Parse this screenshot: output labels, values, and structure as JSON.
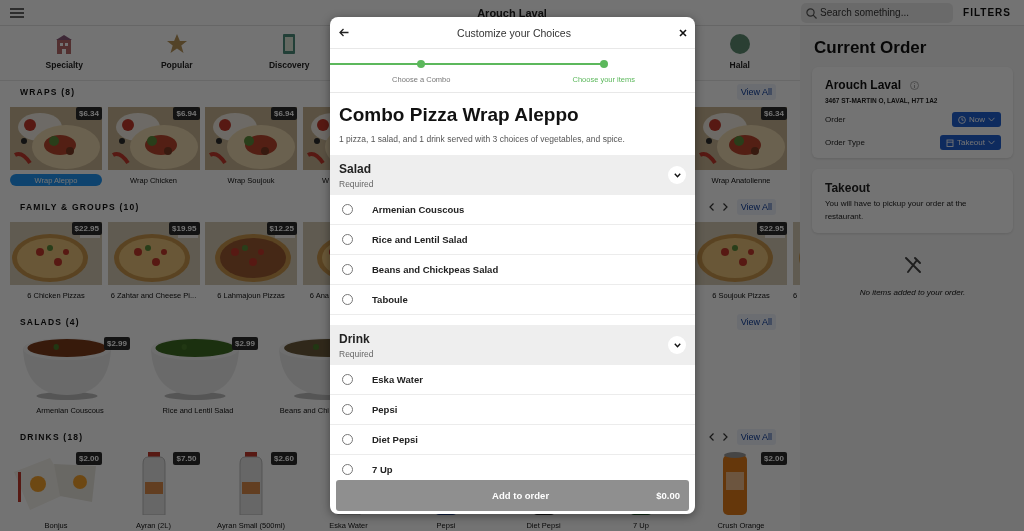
{
  "top_bar": {
    "title": "Arouch Laval",
    "search": {
      "placeholder": "Search something..."
    },
    "filters": "FILTERS"
  },
  "categories": {
    "start": [
      {
        "label": "Specialty"
      },
      {
        "label": "Popular"
      },
      {
        "label": "Discovery"
      }
    ],
    "end": [
      {
        "label": "Halal"
      }
    ]
  },
  "sections": [
    {
      "title": "WRAPS (8)",
      "arrows": false,
      "view_all": "View All",
      "items": [
        {
          "name": "Wrap Aleppo",
          "price": "$6.34",
          "selected": true
        },
        {
          "name": "Wrap Chicken",
          "price": "$6.94",
          "selected": false
        },
        {
          "name": "Wrap Soujouk",
          "price": "$6.94",
          "selected": false
        },
        {
          "name": "W",
          "selected": false
        }
      ],
      "end_items": [
        {
          "name": "Wrap Anatolienne",
          "price": "$6.34",
          "selected": false
        }
      ]
    },
    {
      "title": "FAMILY & GROUPS (10)",
      "arrows": true,
      "view_all": "View All",
      "items": [
        {
          "name": "6 Chicken Pizzas",
          "price": "$22.95",
          "selected": false
        },
        {
          "name": "6 Zahtar and Cheese Pi...",
          "price": "$19.95",
          "selected": false
        },
        {
          "name": "6 Lahmajoun Pizzas",
          "price": "$12.25",
          "selected": false
        },
        {
          "name": "6 Ana",
          "selected": false
        }
      ],
      "end_items": [
        {
          "name": "6 Soujouk Pizzas",
          "price": "$22.95",
          "selected": false
        },
        {
          "name": "6",
          "selected": false
        }
      ]
    },
    {
      "title": "SALADS (4)",
      "arrows": false,
      "view_all": "View All",
      "items": [
        {
          "name": "Armenian Couscous",
          "price": "$2.99",
          "selected": false
        },
        {
          "name": "Rice and Lentil Salad",
          "price": "$2.99",
          "selected": false
        },
        {
          "name": "Beans and Chi",
          "selected": false
        }
      ]
    },
    {
      "title": "DRINKS (18)",
      "arrows": true,
      "view_all": "View All",
      "items": [
        {
          "name": "Bonjus",
          "price": "$2.00",
          "selected": false
        },
        {
          "name": "Ayran (2L)",
          "price": "$7.50",
          "selected": false
        },
        {
          "name": "Ayran Small (500ml)",
          "price": "$2.60",
          "selected": false
        },
        {
          "name": "Eska Water",
          "selected": false
        },
        {
          "name": "Pepsi",
          "selected": false
        },
        {
          "name": "Diet Pepsi",
          "selected": false
        },
        {
          "name": "7 Up",
          "selected": false
        }
      ],
      "end_items": [
        {
          "name": "Crush Orange",
          "price": "$2.00",
          "selected": false
        }
      ]
    }
  ],
  "order": {
    "title": "Current Order",
    "store": {
      "name": "Arouch Laval",
      "address": "3467 ST-MARTIN O, LAVAL, H7T 1A2",
      "rows": [
        {
          "label": "Order",
          "value": "Now",
          "kind": "time"
        },
        {
          "label": "Order Type",
          "value": "Takeout",
          "kind": "bag"
        }
      ]
    },
    "mode": {
      "title": "Takeout",
      "description": "You will have to pickup your order at the restaurant."
    },
    "empty": "No items added to your order."
  },
  "modal": {
    "title": "Customize your Choices",
    "steps": [
      {
        "label": "Choose a Combo",
        "selected": false
      },
      {
        "label": "Choose your items",
        "selected": true
      }
    ],
    "product": {
      "name": "Combo Pizza Wrap Aleppo",
      "description": "1 pizza, 1 salad, and 1 drink served with 3 choices of vegetables, and spice."
    },
    "groups": [
      {
        "name": "Salad",
        "note": "Required",
        "expanded": true,
        "options": [
          {
            "label": "Armenian Couscous",
            "selected": false
          },
          {
            "label": "Rice and Lentil Salad",
            "selected": false
          },
          {
            "label": "Beans and Chickpeas Salad",
            "selected": false
          },
          {
            "label": "Taboule",
            "selected": false
          }
        ]
      },
      {
        "name": "Drink",
        "note": "Required",
        "expanded": true,
        "options": [
          {
            "label": "Eska Water",
            "selected": false
          },
          {
            "label": "Pepsi",
            "selected": false
          },
          {
            "label": "Diet Pepsi",
            "selected": false
          },
          {
            "label": "7 Up",
            "selected": false
          }
        ]
      }
    ],
    "add_button": {
      "label": "Add to order",
      "price": "$0.00",
      "disabled": true
    }
  }
}
